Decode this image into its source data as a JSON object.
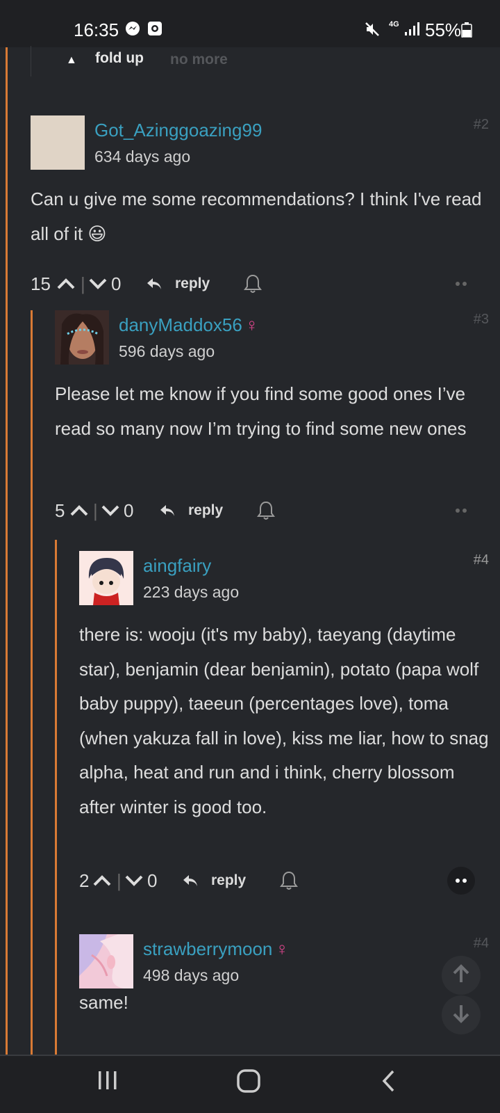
{
  "status_bar": {
    "time": "16:35",
    "network": "4G",
    "battery": "55%",
    "icons": [
      "messenger-icon",
      "camera-icon",
      "mute-icon",
      "signal-icon",
      "battery-icon"
    ]
  },
  "fold": {
    "fold_label": "fold up",
    "no_more_label": "no more"
  },
  "comments": [
    {
      "username": "Got_Azinggoazing99",
      "time": "634 days ago",
      "floor": "#2",
      "text": "Can u give me some recommendations? I think I've read all of it 😃",
      "likes": "15",
      "dislikes": "0",
      "reply_label": "reply",
      "female": false
    },
    {
      "username": "danyMaddox56",
      "time": "596 days ago",
      "floor": "#3",
      "text": "Please let me know if you find some good ones I’ve read so many now I’m trying to find some new ones",
      "likes": "5",
      "dislikes": "0",
      "reply_label": "reply",
      "female": true,
      "gender_symbol": "♀"
    },
    {
      "username": "aingfairy",
      "time": "223 days ago",
      "floor": "#4",
      "text": "there is: wooju (it's my baby), taeyang (daytime star), benjamin (dear benjamin), potato (papa wolf baby puppy), taeeun (percentages love), toma (when yakuza fall in love), kiss me liar, how to snag alpha, heat and run and i think, cherry blossom after winter is good too.",
      "likes": "2",
      "dislikes": "0",
      "reply_label": "reply",
      "female": false
    },
    {
      "username": "strawberrymoon",
      "time": "498 days ago",
      "floor": "#4",
      "text": "same!",
      "female": true,
      "gender_symbol": "♀"
    }
  ],
  "colors": {
    "background": "#25272b",
    "username": "#3aa0c0",
    "thread_line": "#d97a35",
    "female_symbol": "#e0468e"
  }
}
